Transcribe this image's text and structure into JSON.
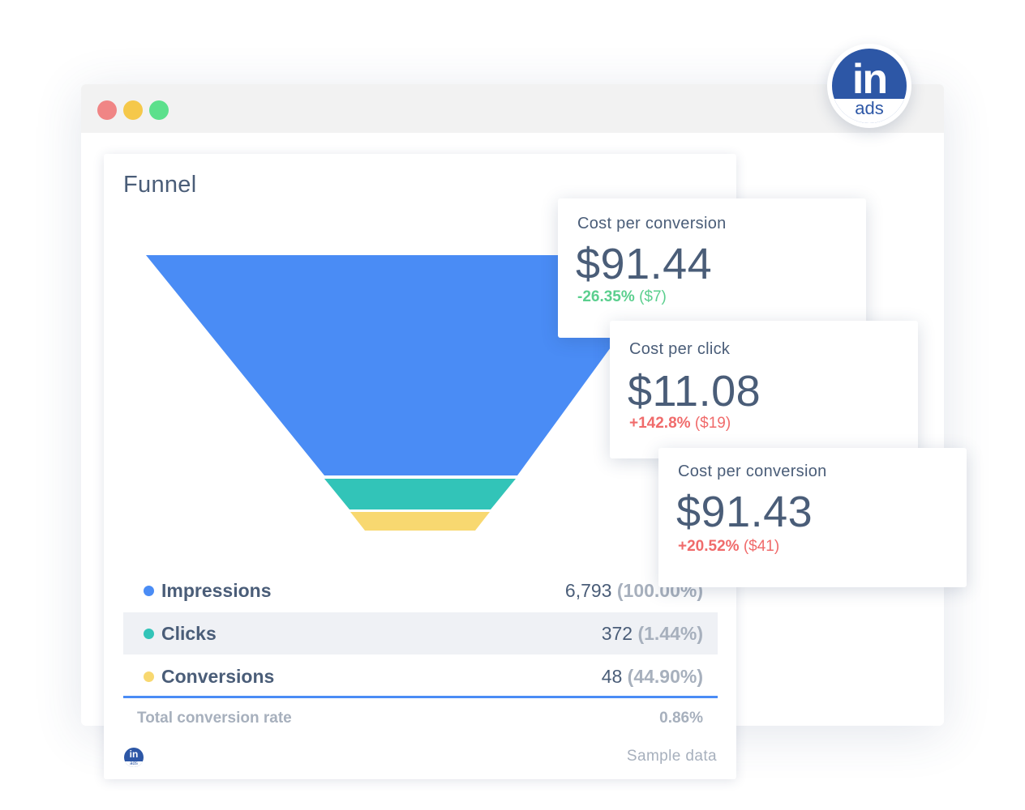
{
  "brand": {
    "badge_word": "in",
    "badge_sub": "ads",
    "primary_color": "#2d57a6"
  },
  "window_controls": [
    "close-dot",
    "minimize-dot",
    "maximize-dot"
  ],
  "funnel": {
    "title": "Funnel",
    "rows": [
      {
        "name": "Impressions",
        "value": "6,793",
        "percent": "(100.00%)",
        "color": "#4a8cf5"
      },
      {
        "name": "Clicks",
        "value": "372",
        "percent": "(1.44%)",
        "color": "#32c4b8"
      },
      {
        "name": "Conversions",
        "value": "48",
        "percent": "(44.90%)",
        "color": "#f8d870"
      }
    ],
    "total_label": "Total conversion rate",
    "total_value": "0.86%",
    "footer_logo_word": "in",
    "footer_logo_sub": "ads",
    "footer_note": "Sample data"
  },
  "metrics": [
    {
      "label": "Cost per conversion",
      "value": "$91.44",
      "change_pct": "-26.35%",
      "change_abs": "($7)",
      "change_color": "#5bcf8e"
    },
    {
      "label": "Cost per click",
      "value": "$11.08",
      "change_pct": "+142.8%",
      "change_abs": "($19)",
      "change_color": "#f06b6b"
    },
    {
      "label": "Cost per conversion",
      "value": "$91.43",
      "change_pct": "+20.52%",
      "change_abs": "($41)",
      "change_color": "#f06b6b"
    }
  ]
}
